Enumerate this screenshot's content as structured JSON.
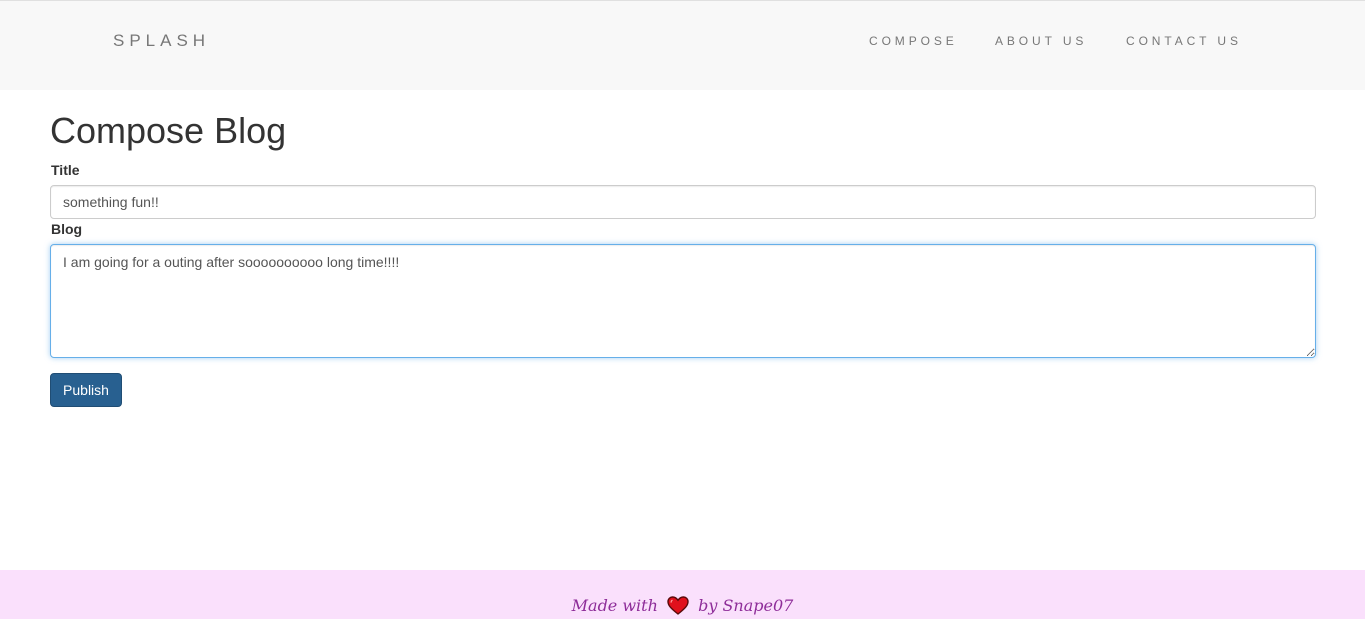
{
  "navbar": {
    "brand": "SPLASH",
    "links": [
      "COMPOSE",
      "ABOUT US",
      "CONTACT US"
    ]
  },
  "page": {
    "heading": "Compose Blog"
  },
  "form": {
    "title_label": "Title",
    "title_value": "something fun!!",
    "blog_label": "Blog",
    "blog_value": "I am going for a outing after soooooooooo long time!!!!",
    "publish_label": "Publish"
  },
  "footer": {
    "prefix": "Made with",
    "suffix": "by Snape07",
    "heart_icon": "heart-icon",
    "heart_color": "#e0101c"
  },
  "colors": {
    "navbar_bg": "#f8f8f8",
    "button_bg": "#286090",
    "footer_bg": "#fae0fc",
    "focus_border": "#66afe9"
  }
}
